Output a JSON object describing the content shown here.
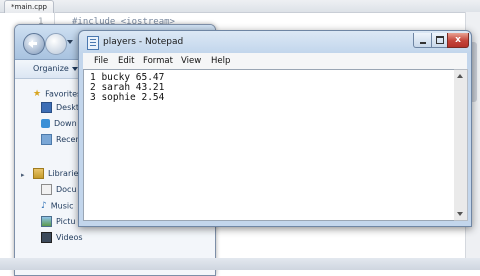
{
  "editor": {
    "tab_label": "*main.cpp",
    "line_number": "1",
    "code_line": "#include <iostream>"
  },
  "explorer": {
    "organize_label": "Organize",
    "favorites_label": "Favorites",
    "favorites_items": [
      "Deskt",
      "Down",
      "Recen"
    ],
    "libraries_label": "Libraries",
    "libraries_items": [
      "Docu",
      "Music",
      "Pictu",
      "Videos"
    ]
  },
  "notepad": {
    "title": "players - Notepad",
    "menu": [
      "File",
      "Edit",
      "Format",
      "View",
      "Help"
    ],
    "lines": [
      "1 bucky 65.47",
      "2 sarah 43.21",
      "3 sophie 2.54"
    ],
    "close_glyph": "x"
  },
  "colors": {
    "titlebar": "#c2d6ec",
    "close_button": "#c4443a",
    "text": "#111111"
  },
  "icons": {
    "favorites": "star-icon",
    "desktop": "desktop-icon",
    "downloads": "downloads-icon",
    "recent": "recent-places-icon",
    "libraries": "library-icon",
    "documents": "documents-icon",
    "music": "music-icon",
    "pictures": "pictures-icon",
    "videos": "videos-icon"
  }
}
